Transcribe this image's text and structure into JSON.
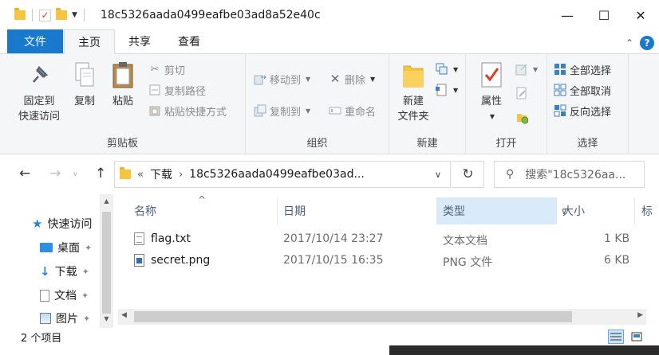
{
  "window": {
    "title": "18c5326aada0499eafbe03ad8a52e40c",
    "minimize": "—",
    "maximize": "☐",
    "close": "✕"
  },
  "ribbon_tabs": [
    "文件",
    "主页",
    "共享",
    "查看"
  ],
  "ribbon": {
    "clipboard": {
      "label": "剪贴板",
      "pin_l1": "固定到",
      "pin_l2": "快速访问",
      "copy": "复制",
      "paste": "粘贴",
      "cut": "剪切",
      "copy_path": "复制路径",
      "paste_shortcut": "粘贴快捷方式"
    },
    "organize": {
      "label": "组织",
      "move_to": "移动到",
      "copy_to": "复制到",
      "delete": "删除",
      "rename": "重命名"
    },
    "new": {
      "label": "新建",
      "new_folder_l1": "新建",
      "new_folder_l2": "文件夹"
    },
    "open": {
      "label": "打开",
      "properties": "属性"
    },
    "select": {
      "label": "选择",
      "select_all": "全部选择",
      "select_none": "全部取消",
      "invert": "反向选择"
    }
  },
  "address": {
    "overflow": "«",
    "crumb1": "下载",
    "crumb2": "18c5326aada0499eafbe03ad...",
    "search_placeholder": "搜索\"18c5326aa..."
  },
  "nav_pane": {
    "items": [
      {
        "label": "快速访问",
        "icon": "star-icon"
      },
      {
        "label": "桌面",
        "icon": "desktop-icon"
      },
      {
        "label": "下载",
        "icon": "download-icon"
      },
      {
        "label": "文档",
        "icon": "document-icon"
      },
      {
        "label": "图片",
        "icon": "pictures-icon"
      }
    ]
  },
  "file_list": {
    "columns": {
      "name": "名称",
      "date": "日期",
      "type": "类型",
      "size": "大小",
      "extra": "标"
    },
    "rows": [
      {
        "name": "flag.txt",
        "date": "2017/10/14 23:27",
        "type": "文本文档",
        "size": "1 KB"
      },
      {
        "name": "secret.png",
        "date": "2017/10/15 16:35",
        "type": "PNG 文件",
        "size": "6 KB"
      }
    ]
  },
  "status": {
    "item_count": "2 个项目"
  },
  "colors": {
    "accent": "#1979ca",
    "sorted_header": "#d9ebf9",
    "ribbon_bg": "#f5f6f7"
  }
}
